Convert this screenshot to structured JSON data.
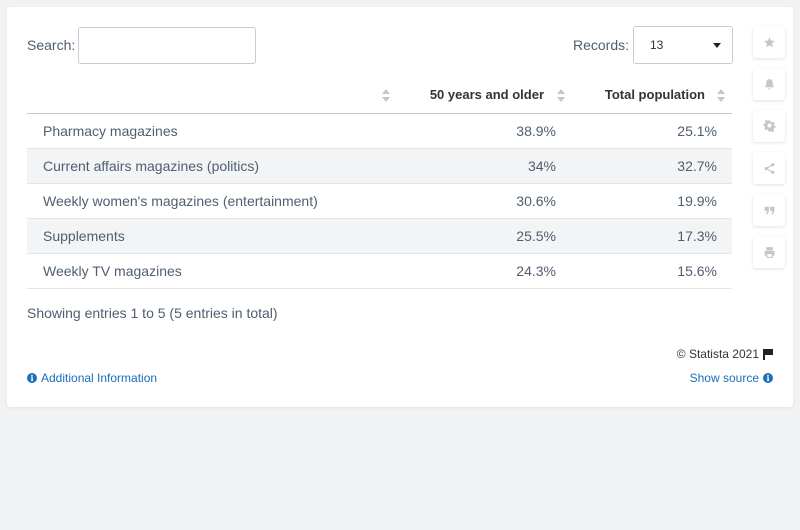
{
  "search": {
    "label": "Search:",
    "value": ""
  },
  "records": {
    "label": "Records:",
    "value": "13"
  },
  "chart_data": {
    "type": "table",
    "columns": [
      "",
      "50 years and older",
      "Total population"
    ],
    "rows": [
      {
        "label": "Pharmacy magazines",
        "values": [
          "38.9%",
          "25.1%"
        ]
      },
      {
        "label": "Current affairs magazines (politics)",
        "values": [
          "34%",
          "32.7%"
        ]
      },
      {
        "label": "Weekly women's magazines (entertainment)",
        "values": [
          "30.6%",
          "19.9%"
        ]
      },
      {
        "label": "Supplements",
        "values": [
          "25.5%",
          "17.3%"
        ]
      },
      {
        "label": "Weekly TV magazines",
        "values": [
          "24.3%",
          "15.6%"
        ]
      }
    ]
  },
  "summary": "Showing entries 1 to 5 (5 entries in total)",
  "footer": {
    "copyright": "© Statista 2021",
    "additional_info": "Additional Information",
    "show_source": "Show source"
  },
  "sidebar": {
    "icons": [
      "star-icon",
      "bell-icon",
      "gear-icon",
      "share-icon",
      "quote-icon",
      "print-icon"
    ]
  },
  "colors": {
    "link": "#1a6fb9",
    "stripe": "#f2f4f6",
    "text": "#4f5e70"
  }
}
